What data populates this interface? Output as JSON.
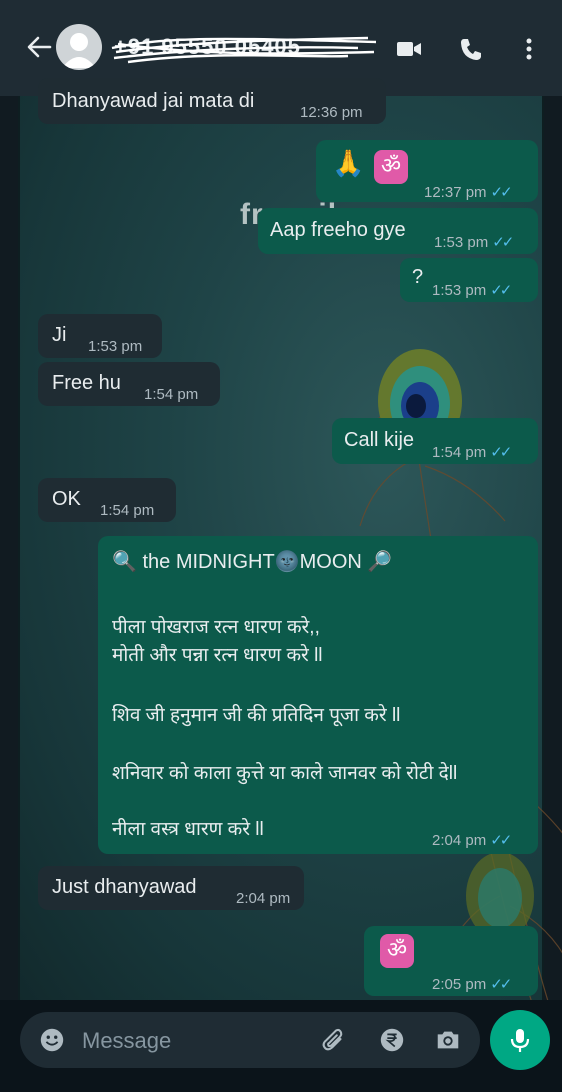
{
  "header": {
    "contact_name": "+91 95550 05405",
    "icons": [
      "back-arrow-icon",
      "avatar",
      "video-call-icon",
      "voice-call-icon",
      "more-options-icon"
    ]
  },
  "wallpaper": {
    "watermark": "freepik"
  },
  "messages": [
    {
      "dir": "in",
      "text": "Dhanyawad jai mata di",
      "time": "12:36 pm"
    },
    {
      "dir": "out",
      "text": "🙏 🕉",
      "time": "12:37 pm",
      "ticks": "✓✓"
    },
    {
      "dir": "out",
      "text": "Aap freeho gye",
      "time": "1:53 pm",
      "ticks": "✓✓"
    },
    {
      "dir": "out",
      "text": "?",
      "time": "1:53 pm",
      "ticks": "✓✓"
    },
    {
      "dir": "in",
      "text": "Ji",
      "time": "1:53 pm"
    },
    {
      "dir": "in",
      "text": "Free hu",
      "time": "1:54 pm"
    },
    {
      "dir": "out",
      "text": "Call kije",
      "time": "1:54 pm",
      "ticks": "✓✓"
    },
    {
      "dir": "in",
      "text": "OK",
      "time": "1:54 pm"
    },
    {
      "dir": "out",
      "lines": [
        "🔍 the MIDNIGHT🌚MOON 🔎",
        "पीला पोखराज रत्न धारण करे,,",
        "मोती और पन्ना रत्न धारण करे ll",
        "शिव जी हनुमान जी की प्रतिदिन पूजा करे ll",
        "शनिवार को काला कुत्ते या काले जानवर को रोटी देll",
        "नीला वस्त्र धारण करे ll"
      ],
      "time": "2:04 pm",
      "ticks": "✓✓"
    },
    {
      "dir": "in",
      "text": "Just dhanyawad",
      "time": "2:04 pm"
    },
    {
      "dir": "out",
      "text": "🕉",
      "time": "2:05 pm",
      "ticks": "✓✓"
    }
  ],
  "input": {
    "placeholder": "Message",
    "icons": [
      "emoji-icon",
      "attach-icon",
      "rupee-payment-icon",
      "camera-icon",
      "mic-icon"
    ]
  },
  "colors": {
    "incoming_bubble": "#1f2c33",
    "outgoing_bubble": "#0c5a4b",
    "read_ticks": "#53bdeb",
    "mic_button": "#00a884"
  }
}
